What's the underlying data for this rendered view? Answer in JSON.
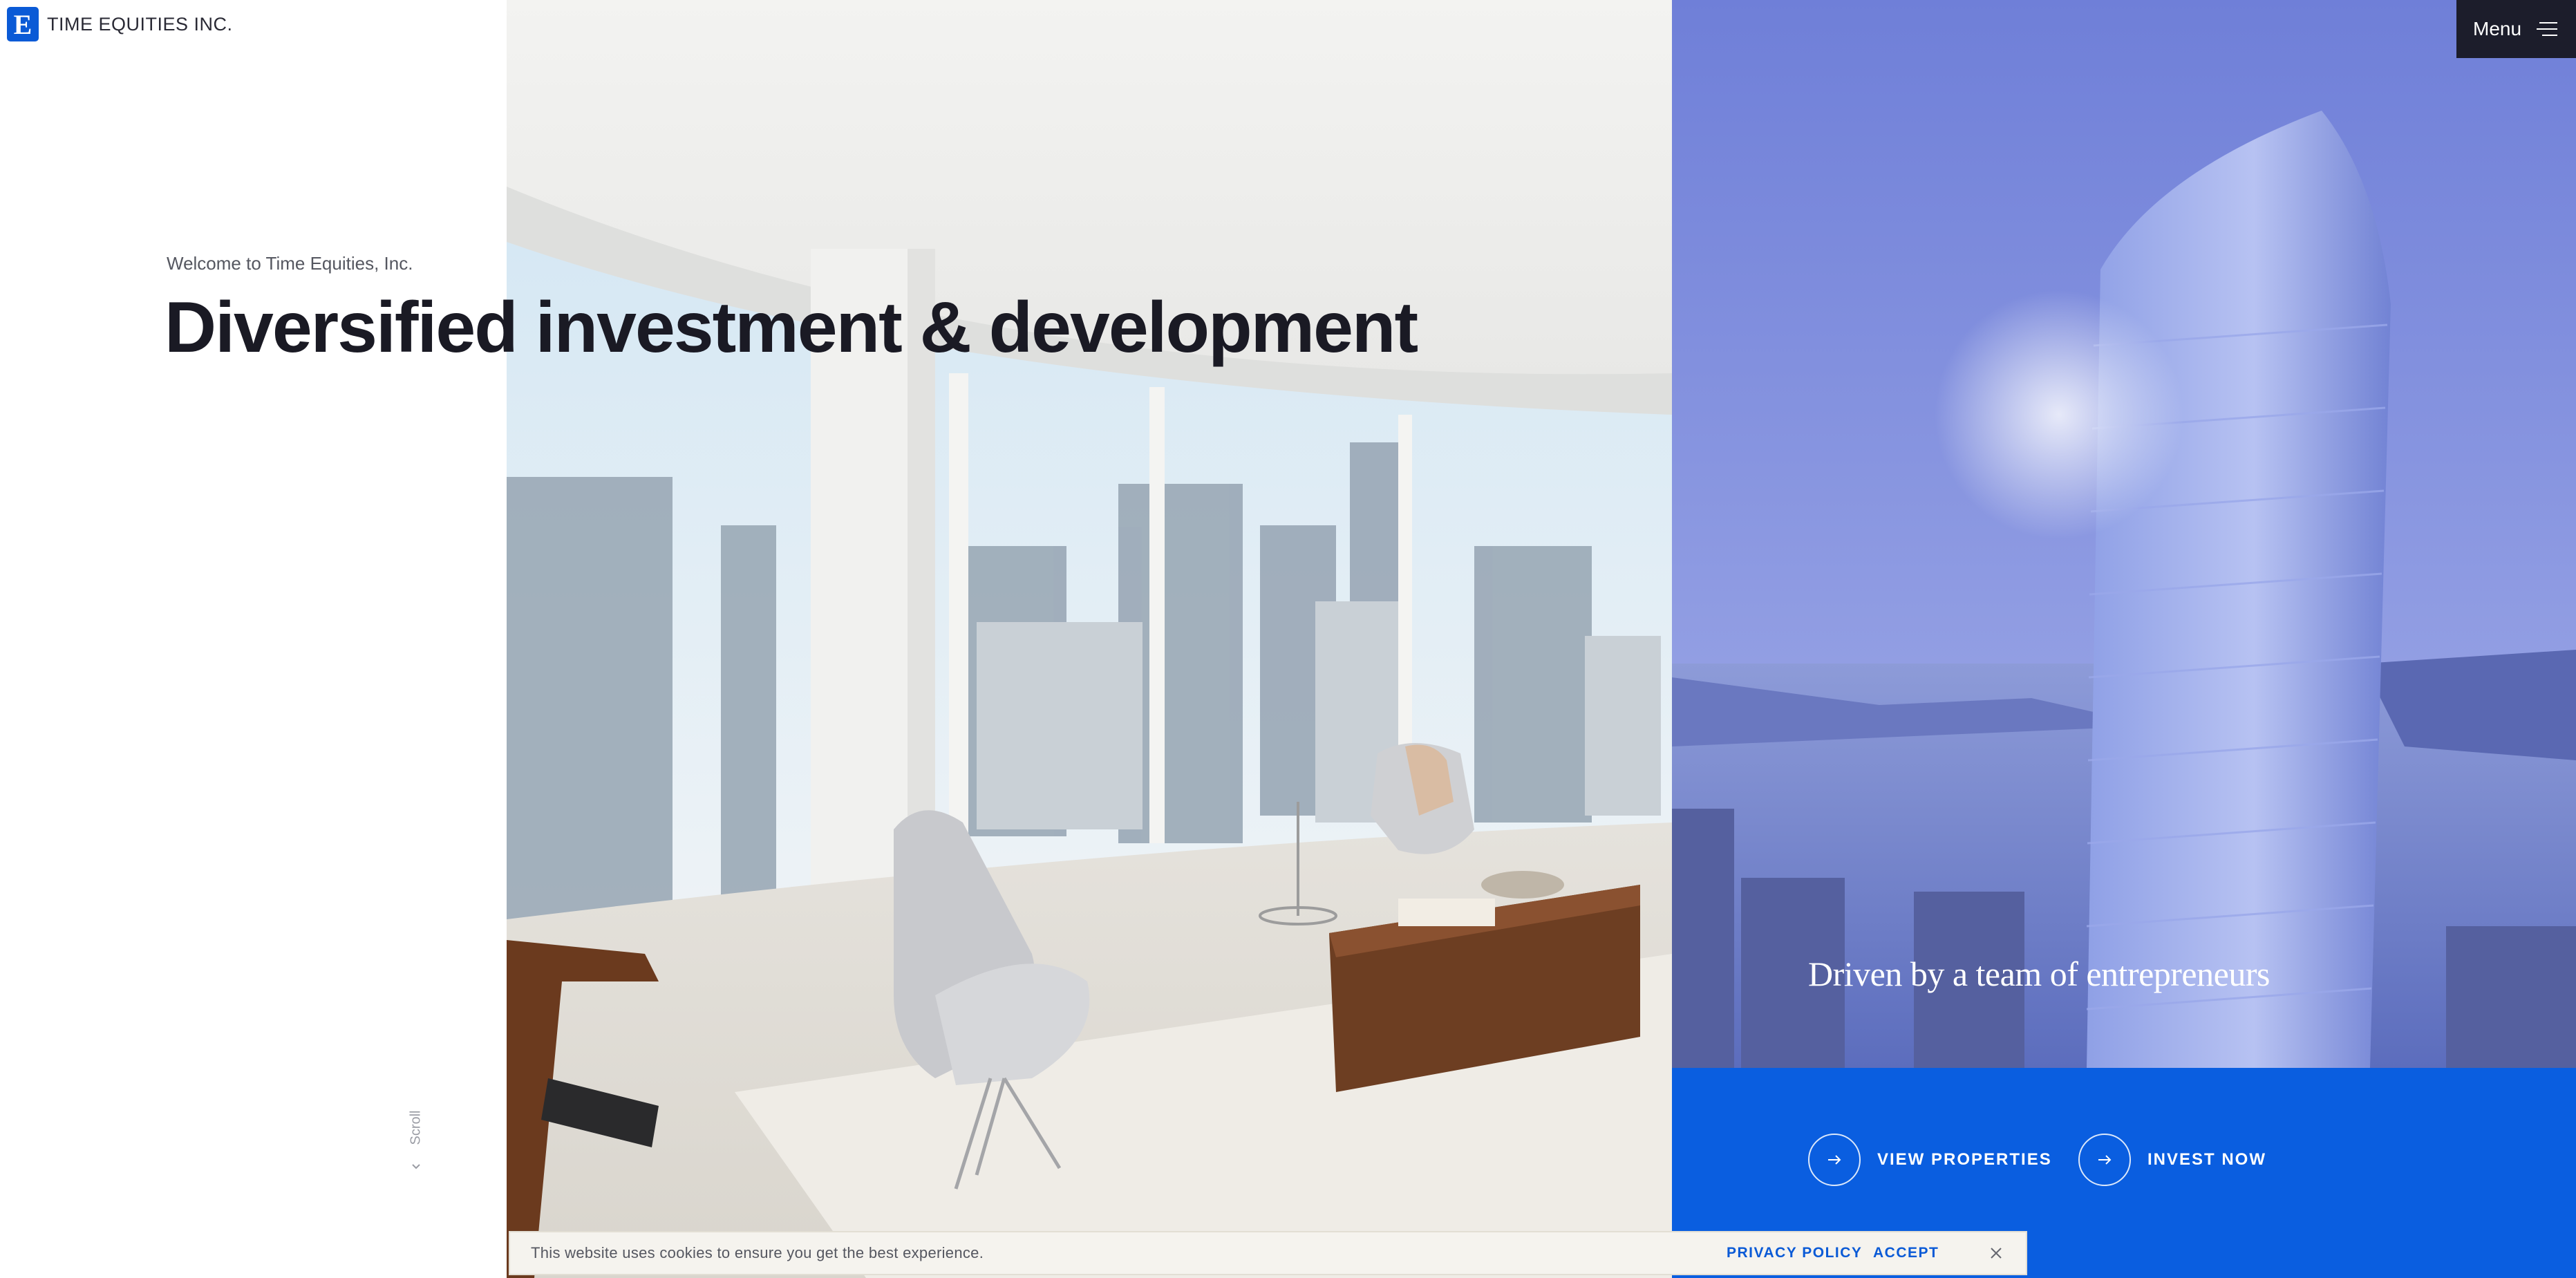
{
  "brand": {
    "logo_letter": "E",
    "name": "TIME EQUITIES INC.",
    "color": "#0a5ad6"
  },
  "hero": {
    "welcome": "Welcome to Time Equities, Inc.",
    "headline": "Diversified investment & development",
    "scroll_label": "Scroll"
  },
  "feature": {
    "tagline": "Driven by a team of entrepreneurs",
    "panel_color": "#0a5ee0",
    "buttons": [
      {
        "label": "VIEW PROPERTIES",
        "icon": "arrow-right-icon"
      },
      {
        "label": "INVEST NOW",
        "icon": "arrow-right-icon"
      }
    ]
  },
  "menu": {
    "label": "Menu",
    "icon": "hamburger-icon",
    "background": "#1c1d2b"
  },
  "cookie_bar": {
    "message": "This website uses cookies to ensure you get the best experience.",
    "privacy_label": "PRIVACY POLICY",
    "accept_label": "ACCEPT",
    "close_icon": "close-icon"
  }
}
